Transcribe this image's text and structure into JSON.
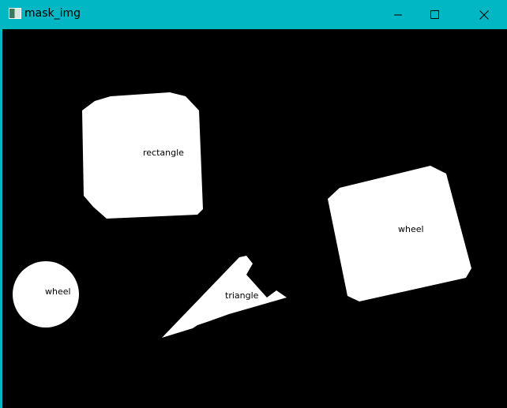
{
  "window": {
    "title": "mask_img",
    "accent": "#00b7c3"
  },
  "controls": {
    "minimize": "minimize-icon",
    "maximize": "maximize-icon",
    "close": "close-icon"
  },
  "labels": {
    "rectangle": "rectangle",
    "wheel_right": "wheel",
    "wheel_left": "wheel",
    "triangle": "triangle"
  }
}
